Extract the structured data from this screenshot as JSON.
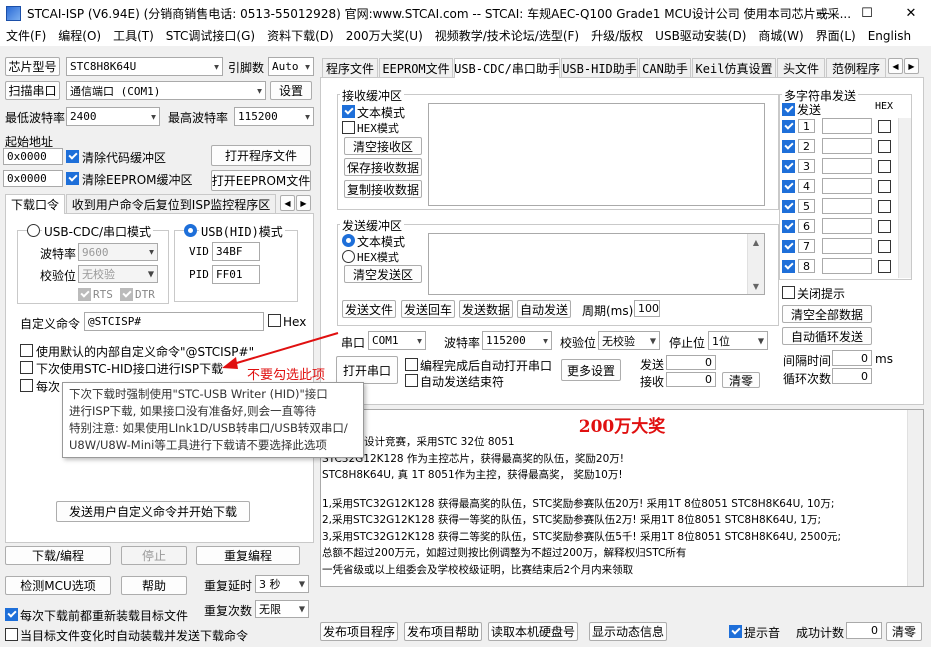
{
  "window": {
    "title": "STCAI-ISP (V6.94E) (分销商销售电话: 0513-55012928) 官网:www.STCAI.com  -- STCAI: 车规AEC-Q100 Grade1 MCU设计公司 使用本司芯片或采..."
  },
  "menu": [
    "文件(F)",
    "编程(O)",
    "工具(T)",
    "STC调试接口(G)",
    "资料下载(D)",
    "200万大奖(U)",
    "视频教学/技术论坛/选型(F)",
    "升级/版权",
    "USB驱动安装(D)",
    "商城(W)",
    "界面(L)",
    "English"
  ],
  "left": {
    "chip_label": "芯片型号",
    "chip_value": "STC8H8K64U",
    "pins_label": "引脚数",
    "pins_value": "Auto",
    "scan_label": "扫描串口",
    "port_value": "通信端口 (COM1)",
    "settings_label": "设置",
    "min_baud_label": "最低波特率",
    "min_baud_value": "2400",
    "max_baud_label": "最高波特率",
    "max_baud_value": "115200",
    "start_addr_label": "起始地址",
    "addr1": "0x0000",
    "clear_code": "清除代码缓冲区",
    "open_prog": "打开程序文件",
    "addr2": "0x0000",
    "clear_eeprom": "清除EEPROM缓冲区",
    "open_eeprom": "打开EEPROM文件",
    "tabs": [
      "下载口令",
      "收到用户命令后复位到ISP监控程序区"
    ],
    "cdc_mode": "USB-CDC/串口模式",
    "baud_label": "波特率",
    "baud_value": "9600",
    "parity_label": "校验位",
    "parity_value": "无校验",
    "rts": "RTS",
    "dtr": "DTR",
    "hid_mode": "USB(HID)模式",
    "vid_label": "VID",
    "vid_value": "34BF",
    "pid_label": "PID",
    "pid_value": "FF01",
    "custom_cmd_label": "自定义命令",
    "custom_cmd_value": "@STCISP#",
    "hex_label": "Hex",
    "opt_default": "使用默认的内部自定义命令\"@STCISP#\"",
    "opt_hid": "下次使用STC-HID接口进行ISP下载",
    "opt_each": "每次",
    "send_custom": "发送用户自定义命令并开始下载",
    "download": "下载/编程",
    "stop": "停止",
    "reprogram": "重复编程",
    "detect": "检测MCU选项",
    "help": "帮助",
    "repeat_delay_label": "重复延时",
    "repeat_delay_value": "3 秒",
    "repeat_count_label": "重复次数",
    "repeat_count_value": "无限",
    "reload_each": "每次下载前都重新装载目标文件",
    "auto_load": "当目标文件变化时自动装载并发送下载命令"
  },
  "tooltip": {
    "lines": [
      "下次下载时强制使用\"STC-USB Writer (HID)\"接口",
      "进行ISP下载, 如果接口没有准备好,则会一直等待",
      "特别注意: 如果使用LInk1D/USB转串口/USB转双串口/",
      "U8W/U8W-Mini等工具进行下载请不要选择此选项"
    ]
  },
  "annotation": "不要勾选此项",
  "right": {
    "tabs": [
      "程序文件",
      "EEPROM文件",
      "USB-CDC/串口助手",
      "USB-HID助手",
      "CAN助手",
      "Keil仿真设置",
      "头文件",
      "范例程序"
    ],
    "recv_group": "接收缓冲区",
    "send_group": "发送缓冲区",
    "text_mode": "文本模式",
    "hex_mode": "HEX模式",
    "clear_recv": "清空接收区",
    "save_recv": "保存接收数据",
    "copy_recv": "复制接收数据",
    "clear_send": "清空发送区",
    "send_file": "发送文件",
    "send_back": "发送回车",
    "send_data": "发送数据",
    "auto_send": "自动发送",
    "period_label": "周期(ms)",
    "period_value": "100",
    "serial_label": "串口",
    "serial_value": "COM1",
    "baud_label": "波特率",
    "baud_value": "115200",
    "parity_label": "校验位",
    "parity_value": "无校验",
    "stop_label": "停止位",
    "stop_value": "1位",
    "open_serial": "打开串口",
    "auto_open": "编程完成后自动打开串口",
    "auto_end": "自动发送结束符",
    "more": "更多设置",
    "sent_label": "发送",
    "sent_value": "0",
    "recv_label": "接收",
    "recv_value": "0",
    "clear_count": "清零",
    "multi_title": "多字符串发送",
    "multi_send": "发送",
    "multi_hex": "HEX",
    "multi_rows": [
      "1",
      "2",
      "3",
      "4",
      "5",
      "6",
      "7",
      "8"
    ],
    "close_tip": "关闭提示",
    "clear_all": "清空全部数据",
    "auto_loop": "自动循环发送",
    "interval_label": "间隔时间",
    "interval_value": "0",
    "interval_unit": "ms",
    "loop_label": "循环次数",
    "loop_value": "0"
  },
  "outline": {
    "heading": "200万大奖",
    "lines": [
      "学生电子设计竞赛，采用STC 32位 8051",
      "STC32G12K128 作为主控芯片，获得最高奖的队伍，奖励20万!",
      "STC8H8K64U, 真 1T 8051作为主控，获得最高奖， 奖励10万!",
      "",
      "1,采用STC32G12K128 获得最高奖的队伍，STC奖励参赛队伍20万! 采用1T 8位8051 STC8H8K64U, 10万;",
      "2,采用STC32G12K128 获得一等奖的队伍，STC奖励参赛队伍2万!  采用1T 8位8051 STC8H8K64U, 1万;",
      "3,采用STC32G12K128 获得二等奖的队伍，STC奖励参赛队伍5千!  采用1T 8位8051 STC8H8K64U, 2500元;",
      "总额不超过200万元，如超过则按比例调整为不超过200万，解释权归STC所有",
      "一凭省级或以上组委会及学校校级证明，比赛结束后2个月内来领取"
    ]
  },
  "bottom": {
    "publish_project": "发布项目程序",
    "publish_help": "发布项目帮助",
    "read_disk": "读取本机硬盘号",
    "show_info": "显示动态信息",
    "beep": "提示音",
    "success_label": "成功计数",
    "success_value": "0",
    "clear": "清零"
  }
}
